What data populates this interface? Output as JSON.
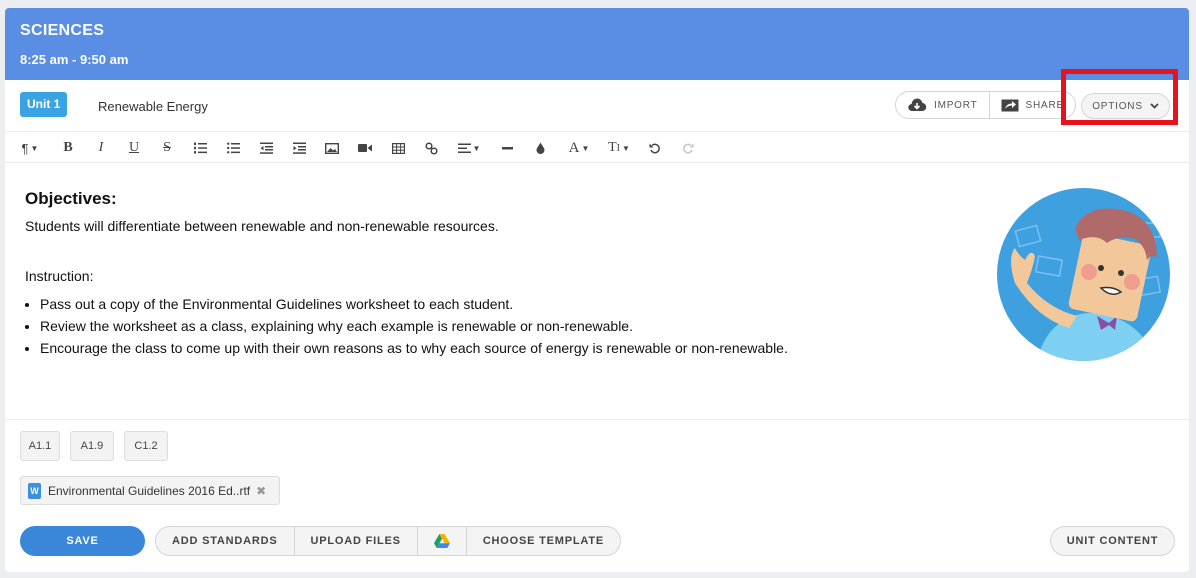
{
  "header": {
    "title": "SCIENCES",
    "time": "8:25 am - 9:50 am"
  },
  "topbar": {
    "unit_badge": "Unit 1",
    "unit_name": "Renewable Energy",
    "import_label": "IMPORT",
    "share_label": "SHARE",
    "options_label": "OPTIONS"
  },
  "toolbar": {
    "icons": [
      "paragraph-icon",
      "bold-icon",
      "italic-icon",
      "underline-icon",
      "strikethrough-icon",
      "ordered-list-icon",
      "bulleted-list-icon",
      "outdent-icon",
      "indent-icon",
      "image-icon",
      "video-icon",
      "table-icon",
      "link-icon",
      "align-icon",
      "horizontal-rule-icon",
      "color-icon",
      "font-icon",
      "font-size-icon",
      "undo-icon",
      "redo-icon"
    ]
  },
  "content": {
    "objectives_title": "Objectives:",
    "objectives_text": "Students will differentiate between renewable and non-renewable resources.",
    "instruction_label": "Instruction:",
    "instruction_items": [
      "Pass out a copy of the Environmental Guidelines worksheet to each student.",
      "Review the worksheet as a class, explaining why each example is renewable or non-renewable.",
      "Encourage the class to come up with their own reasons as to why each source of energy is renewable or non-renewable."
    ]
  },
  "standards": [
    "A1.1",
    "A1.9",
    "C1.2"
  ],
  "attachment": {
    "file_name": "Environmental Guidelines 2016 Ed..rtf",
    "icon_letter": "W"
  },
  "actions": {
    "save_label": "SAVE",
    "add_standards_label": "ADD STANDARDS",
    "upload_files_label": "UPLOAD FILES",
    "choose_template_label": "CHOOSE TEMPLATE",
    "unit_content_label": "UNIT CONTENT"
  },
  "colors": {
    "header": "#5a8de4",
    "accent": "#3a87d9",
    "highlight": "#e8131a"
  }
}
